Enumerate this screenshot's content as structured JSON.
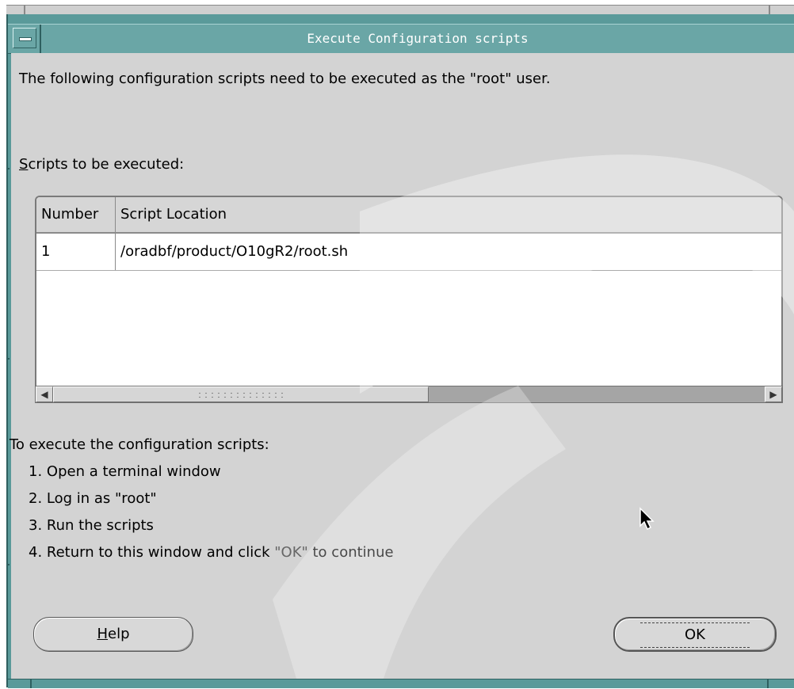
{
  "window": {
    "title": "Execute Configuration scripts"
  },
  "dialog": {
    "intro": "The following configuration scripts need to be executed as the \"root\" user.",
    "scripts_label_mnemonic": "S",
    "scripts_label_rest": "cripts to be executed:",
    "table": {
      "columns": [
        "Number",
        "Script Location"
      ],
      "rows": [
        {
          "number": "1",
          "location": "/oradbf/product/O10gR2/root.sh"
        }
      ]
    },
    "instructions_heading": "To execute the configuration scripts:",
    "steps": [
      "1. Open a terminal window",
      "2. Log in as \"root\"",
      "3. Run the scripts"
    ],
    "step4_prefix": "4. Return to this window and click ",
    "step4_ok": "\"OK\"",
    "step4_suffix": " to continue",
    "help_mnemonic": "H",
    "help_rest": "elp",
    "ok_label": "OK"
  },
  "icons": {
    "window_menu": "window-menu-icon",
    "scroll_left": "scroll-left-arrow-icon",
    "scroll_right": "scroll-right-arrow-icon",
    "cursor": "mouse-pointer-icon"
  },
  "colors": {
    "titlebar": "#6aa6a6",
    "dialog_bg": "#d3d3d3",
    "table_bg": "#ffffff"
  }
}
